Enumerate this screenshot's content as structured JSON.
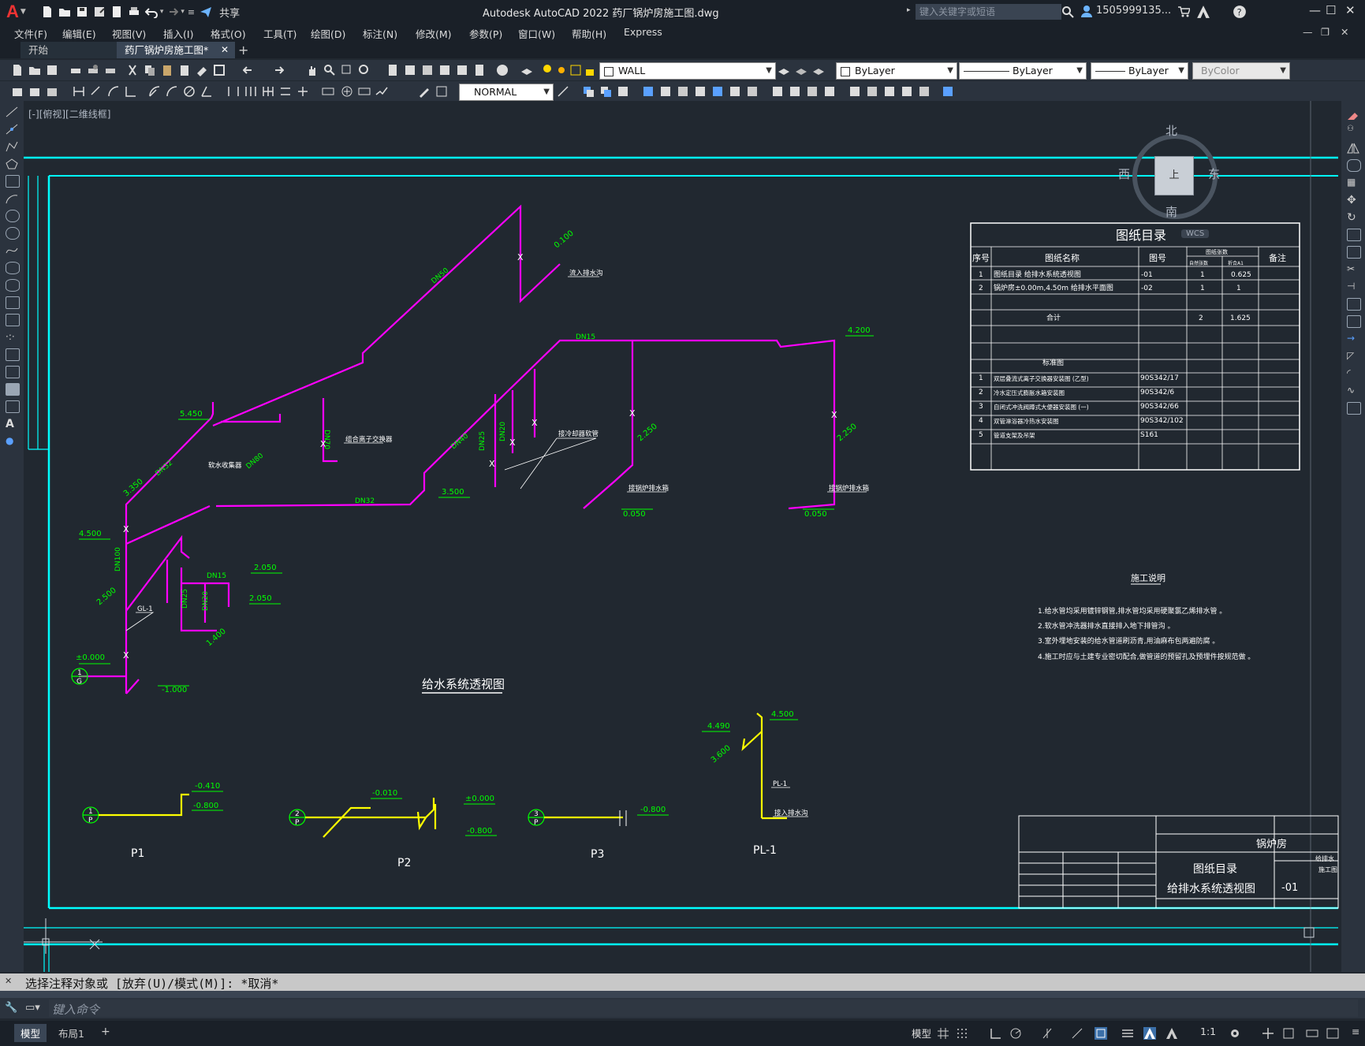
{
  "app": {
    "title": "Autodesk AutoCAD 2022    药厂锅炉房施工图.dwg",
    "share": "共享",
    "search_placeholder": "键入关键字或短语",
    "user": "1505999135...",
    "logo": "A"
  },
  "menu": [
    "文件(F)",
    "编辑(E)",
    "视图(V)",
    "插入(I)",
    "格式(O)",
    "工具(T)",
    "绘图(D)",
    "标注(N)",
    "修改(M)",
    "参数(P)",
    "窗口(W)",
    "帮助(H)",
    "Express"
  ],
  "tabs": [
    {
      "label": "开始"
    },
    {
      "label": "药厂锅炉房施工图*"
    }
  ],
  "toolbar": {
    "layer": "WALL",
    "color": "ByLayer",
    "linetype": "ByLayer",
    "lineweight": "ByLayer",
    "plotstyle": "ByColor",
    "dimstyle": "NORMAL"
  },
  "viewport": {
    "label": "[-][俯视][二维线框]"
  },
  "viewcube": {
    "north": "北",
    "south": "南",
    "east": "东",
    "west": "西",
    "center": "上",
    "wcs": "WCS"
  },
  "drawing": {
    "main_title": "给水系统透视图",
    "pipes": [
      "DN50",
      "DN15",
      "DN70",
      "DN32",
      "DN40",
      "DN25",
      "DN20",
      "DN80",
      "DN100",
      "DN15",
      "DN25",
      "DN20",
      "DN32"
    ],
    "levels": [
      "0.100",
      "4.200",
      "5.450",
      "3.350",
      "4.500",
      "3.500",
      "2.050",
      "2.050",
      "2.500",
      "±0.000",
      "-1.000",
      "1.400",
      "2.250",
      "2.250",
      "0.050",
      "0.050",
      "4.490",
      "4.500",
      "3.600",
      "-0.410",
      "-0.800",
      "-0.010",
      "±0.000",
      "-0.800",
      "-0.800"
    ],
    "notes_left": [
      "流入排水沟",
      "组合离子交换器",
      "软水收集器",
      "接冷却器软管",
      "软水器反冲排水管",
      "接锅炉排水箱",
      "接锅炉排水箱",
      "GL-1",
      "PL-1",
      "接入排水沟"
    ],
    "sub_titles": [
      "P1",
      "P2",
      "P3",
      "PL-1"
    ],
    "circle_labels": [
      {
        "n": "1",
        "l": "G"
      },
      {
        "n": "1",
        "l": "P"
      },
      {
        "n": "2",
        "l": "P"
      },
      {
        "n": "3",
        "l": "P"
      }
    ],
    "index_table": {
      "title": "图纸目录",
      "headers": [
        "序号",
        "图纸名称",
        "图号",
        "图纸张数",
        "备注"
      ],
      "subheaders": [
        "自然张数",
        "折合A1"
      ],
      "rows": [
        [
          "1",
          "图纸目录      给排水系统透视图",
          "-01",
          "1",
          "0.625"
        ],
        [
          "2",
          "锅炉房±0.00m,4.50m     给排水平面图",
          "-02",
          "1",
          "1"
        ],
        [
          "",
          "合计",
          "",
          "2",
          "1.625"
        ],
        [
          "",
          "标准图",
          "",
          "",
          ""
        ],
        [
          "1",
          "双层叠流式离子交换器安装图    (乙型)",
          "90S342/17",
          "",
          ""
        ],
        [
          "2",
          "冷水定压式膨胀水箱安装图",
          "90S342/6",
          "",
          ""
        ],
        [
          "3",
          "自闭式冲洗阀蹲式大便器安装图    (一)",
          "90S342/66",
          "",
          ""
        ],
        [
          "4",
          "双管淋浴器冷热水安装图",
          "90S342/102",
          "",
          ""
        ],
        [
          "5",
          "管道支架及吊架",
          "S161",
          "",
          ""
        ]
      ]
    },
    "construction_notes": {
      "title": "施工说明",
      "items": [
        "1.给水管均采用镀锌钢管,排水管均采用硬聚氯乙烯排水管 。",
        "2.软水管冲洗器排水直接排入地下排管沟 。",
        "3.室外埋地安装的给水管道刷沥青,用油麻布包两遍防腐 。",
        "4.施工时应与土建专业密切配合,做管道的预留孔及预埋件按规范做 。"
      ]
    },
    "title_block": {
      "project": "锅炉房",
      "drawing_name_1": "图纸目录",
      "drawing_name_2": "给排水系统透视图",
      "number": "-01",
      "side_1": "给排水",
      "side_2": "施工图"
    }
  },
  "command": {
    "history": "选择注释对象或 [放弃(U)/模式(M)]: *取消*",
    "placeholder": "键入命令"
  },
  "status": {
    "tabs": [
      "模型",
      "布局1"
    ],
    "model": "模型",
    "scale": "1:1"
  },
  "colors": {
    "pipe": "#ff00ff",
    "text": "#00ff00",
    "frame": "#00ffff",
    "yellow": "#ffff00",
    "white": "#ffffff"
  }
}
